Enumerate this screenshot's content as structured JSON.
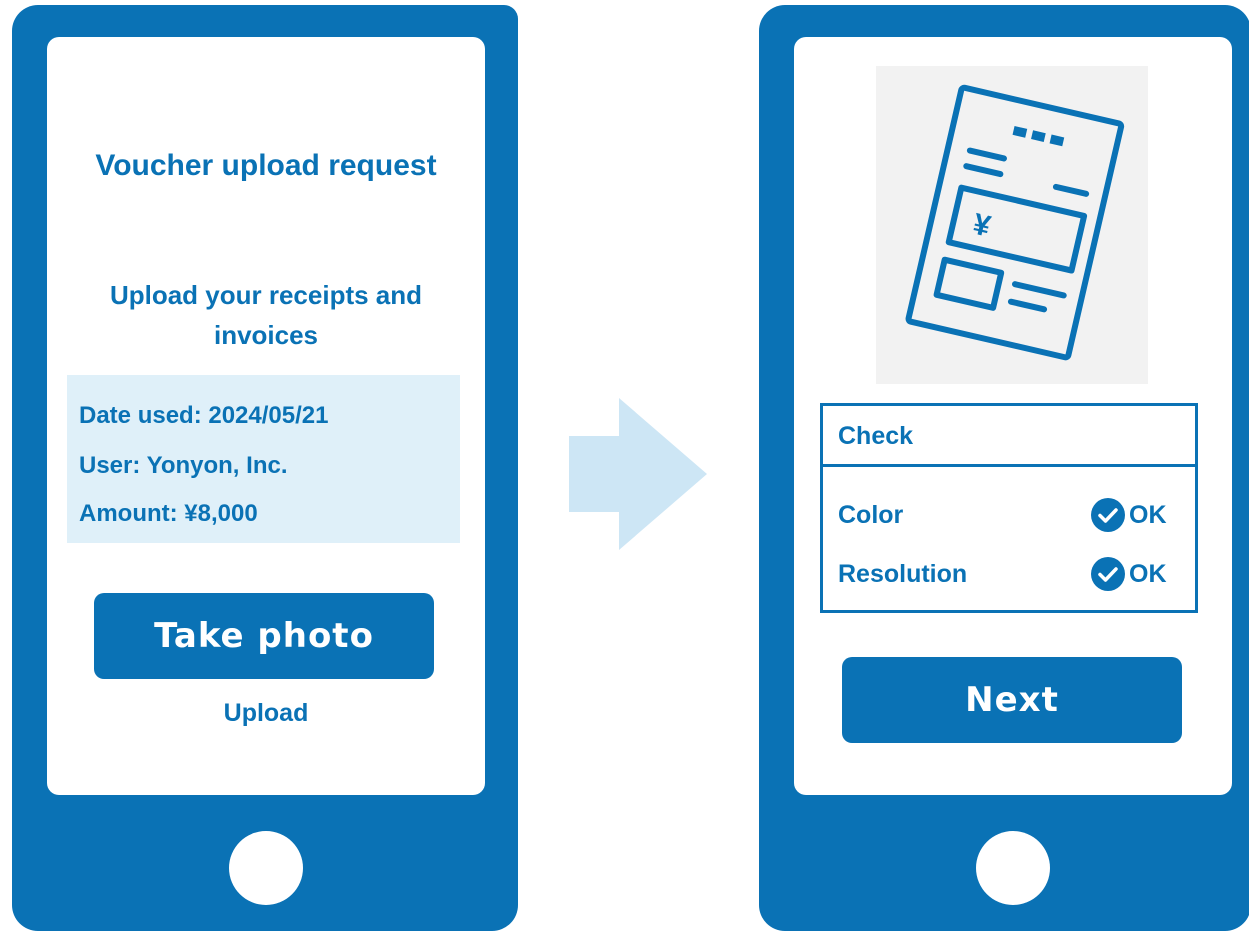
{
  "upload_screen": {
    "title": "Voucher upload request",
    "subtitle": "Upload your receipts and invoices",
    "details": {
      "date_used": "Date used: 2024/05/21",
      "user": "User: Yonyon, Inc.",
      "amount": "Amount: ¥8,000"
    },
    "take_photo_label": "Take photo",
    "upload_label": "Upload"
  },
  "check_screen": {
    "receipt_currency_symbol": "¥",
    "check_title": "Check",
    "checks": [
      {
        "label": "Color",
        "status": "OK"
      },
      {
        "label": "Resolution",
        "status": "OK"
      }
    ],
    "next_label": "Next"
  },
  "colors": {
    "brand_blue": "#0a72b5",
    "info_background": "#dff0f9",
    "arrow": "#cde6f5",
    "photo_background": "#f2f2f2"
  },
  "icons": {
    "flow_arrow": "arrow-right-icon",
    "receipt": "receipt-icon",
    "check": "check-circle-icon"
  }
}
